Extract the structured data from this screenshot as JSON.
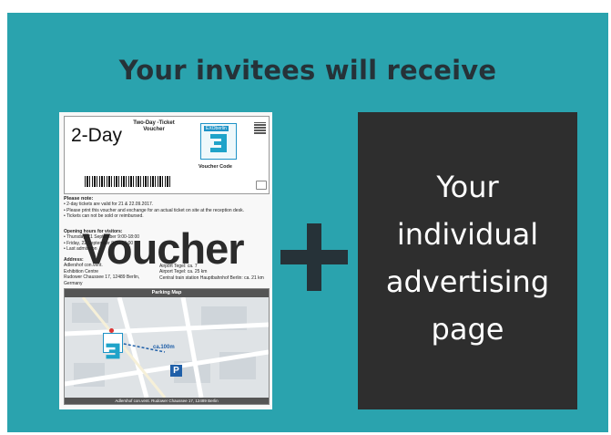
{
  "heading": "Your invitees will receive",
  "voucher": {
    "day_label": "2-Day",
    "ticket_title": "Two-Day -Ticket",
    "ticket_subtitle": "Voucher",
    "logo_text": "EXOberlin",
    "voucher_code_label": "Voucher Code",
    "note_title": "Please note:",
    "notes": [
      "• 2-day tickets are valid for 21 & 22.09.2017.",
      "• Please print this voucher and exchange for an actual ticket on site at the reception desk.",
      "• Tickets can not be sold or reimbursed."
    ],
    "opening_title": "Opening hours for visitors:",
    "opening_lines": [
      "• Thursday, 21 September 9:00-18:00",
      "• Friday, 22 September 9:00-16:00",
      "• Last admission"
    ],
    "address_title": "Address:",
    "address_lines": [
      "Adlershof con.vent.",
      "Exhibition Centre",
      "Rudower Chaussee 17, 12489 Berlin,",
      "Germany"
    ],
    "address_right_lines": [
      "Airport Tegel: ca. 7",
      "Airport Tegel: ca. 25 km",
      "Central train station Hauptbahnhof Berlin: ca. 21 km"
    ],
    "overlay_word": "Voucher",
    "map_title": "Parking Map",
    "map_distance": "ca.100m",
    "map_parking": "P",
    "map_footer": "Adlershof con.vent. Rudower Chaussee 17, 12489 Berlin"
  },
  "plus_symbol": "+",
  "ad_panel": {
    "lines": [
      "Your",
      "individual",
      "advertising",
      "page"
    ]
  }
}
